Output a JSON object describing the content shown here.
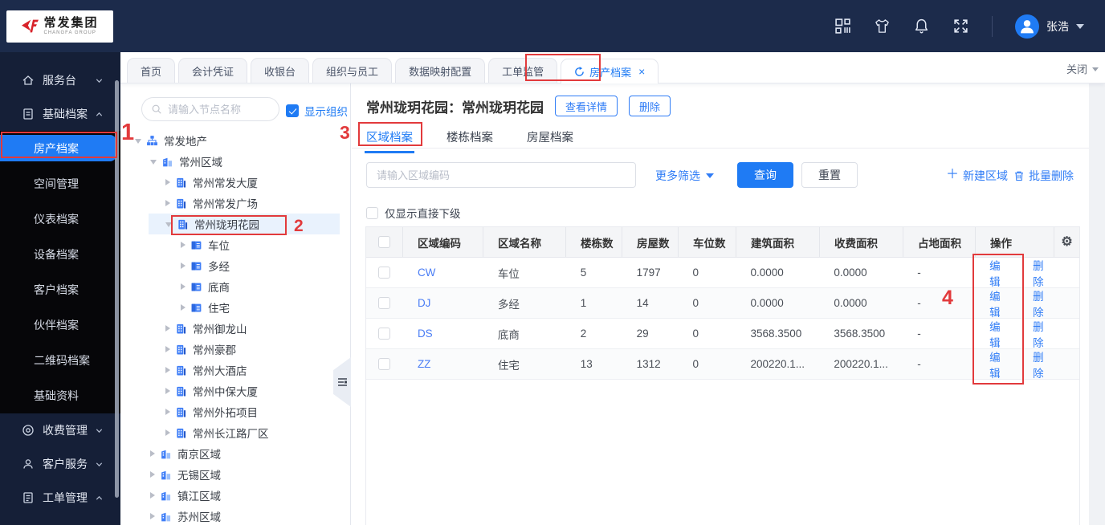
{
  "header": {
    "logo": {
      "title": "常发集团",
      "subtitle": "CHANGFA GROUP"
    },
    "icons": [
      "qrcode-icon",
      "theme-shirt-icon",
      "notifications-bell-icon",
      "fullscreen-icon"
    ],
    "user_name": "张浩"
  },
  "tab_bar": {
    "tabs": [
      {
        "label": "首页"
      },
      {
        "label": "会计凭证"
      },
      {
        "label": "收银台"
      },
      {
        "label": "组织与员工"
      },
      {
        "label": "数据映射配置"
      },
      {
        "label": "工单监管"
      },
      {
        "label": "房产档案",
        "active": true,
        "closable": true
      }
    ],
    "close_menu_label": "关闭"
  },
  "sidebar": {
    "groups": [
      {
        "label": "服务台",
        "icon": "home",
        "chevron": "down"
      },
      {
        "label": "基础档案",
        "icon": "archive",
        "chevron": "up",
        "children": [
          {
            "label": "房产档案",
            "active": true
          },
          {
            "label": "空间管理"
          },
          {
            "label": "仪表档案"
          },
          {
            "label": "设备档案"
          },
          {
            "label": "客户档案"
          },
          {
            "label": "伙伴档案"
          },
          {
            "label": "二维码档案"
          },
          {
            "label": "基础资料"
          }
        ]
      },
      {
        "label": "收费管理",
        "icon": "fee",
        "chevron": "down"
      },
      {
        "label": "客户服务",
        "icon": "customer",
        "chevron": "down"
      },
      {
        "label": "工单管理",
        "icon": "workorder",
        "chevron": "up"
      }
    ]
  },
  "tree_panel": {
    "search_placeholder": "请输入节点名称",
    "show_org": {
      "label": "显示组织",
      "checked": true
    },
    "nodes": [
      {
        "label": "常发地产",
        "level": 0,
        "icon": "org",
        "state": "open"
      },
      {
        "label": "常州区域",
        "level": 1,
        "icon": "region",
        "state": "open"
      },
      {
        "label": "常州常发大厦",
        "level": 2,
        "icon": "project",
        "state": "closed"
      },
      {
        "label": "常州常发广场",
        "level": 2,
        "icon": "project",
        "state": "closed"
      },
      {
        "label": "常州珑玥花园",
        "level": 2,
        "icon": "project",
        "state": "open",
        "selected": true
      },
      {
        "label": "车位",
        "level": 3,
        "icon": "category",
        "state": "closed"
      },
      {
        "label": "多经",
        "level": 3,
        "icon": "category",
        "state": "closed"
      },
      {
        "label": "底商",
        "level": 3,
        "icon": "category",
        "state": "closed"
      },
      {
        "label": "住宅",
        "level": 3,
        "icon": "category",
        "state": "closed"
      },
      {
        "label": "常州御龙山",
        "level": 2,
        "icon": "project",
        "state": "closed"
      },
      {
        "label": "常州豪郡",
        "level": 2,
        "icon": "project",
        "state": "closed"
      },
      {
        "label": "常州大酒店",
        "level": 2,
        "icon": "project",
        "state": "closed"
      },
      {
        "label": "常州中保大厦",
        "level": 2,
        "icon": "project",
        "state": "closed"
      },
      {
        "label": "常州外拓项目",
        "level": 2,
        "icon": "project",
        "state": "closed"
      },
      {
        "label": "常州长江路厂区",
        "level": 2,
        "icon": "project",
        "state": "closed"
      },
      {
        "label": "南京区域",
        "level": 1,
        "icon": "region",
        "state": "closed"
      },
      {
        "label": "无锡区域",
        "level": 1,
        "icon": "region",
        "state": "closed"
      },
      {
        "label": "镇江区域",
        "level": 1,
        "icon": "region",
        "state": "closed"
      },
      {
        "label": "苏州区域",
        "level": 1,
        "icon": "region",
        "state": "closed"
      }
    ]
  },
  "main": {
    "title": "常州珑玥花园：常州珑玥花园",
    "actions": {
      "view_detail": "查看详情",
      "delete": "删除"
    },
    "tabs": [
      {
        "label": "区域档案",
        "active": true
      },
      {
        "label": "楼栋档案"
      },
      {
        "label": "房屋档案"
      }
    ],
    "filter": {
      "placeholder": "请输入区域编码",
      "more_filters": "更多筛选",
      "query": "查询",
      "reset": "重置",
      "create_region": "新建区域",
      "batch_delete": "批量删除"
    },
    "only_direct_label": "仅显示直接下级",
    "table": {
      "columns": [
        "区域编码",
        "区域名称",
        "楼栋数",
        "房屋数",
        "车位数",
        "建筑面积",
        "收费面积",
        "占地面积",
        "操作"
      ],
      "rows": [
        {
          "code": "CW",
          "name": "车位",
          "buildings": "5",
          "houses": "1797",
          "parking": "0",
          "build_area": "0.0000",
          "charge_area": "0.0000",
          "land_area": "-"
        },
        {
          "code": "DJ",
          "name": "多经",
          "buildings": "1",
          "houses": "14",
          "parking": "0",
          "build_area": "0.0000",
          "charge_area": "0.0000",
          "land_area": "-"
        },
        {
          "code": "DS",
          "name": "底商",
          "buildings": "2",
          "houses": "29",
          "parking": "0",
          "build_area": "3568.3500",
          "charge_area": "3568.3500",
          "land_area": "-"
        },
        {
          "code": "ZZ",
          "name": "住宅",
          "buildings": "13",
          "houses": "1312",
          "parking": "0",
          "build_area": "200220.1...",
          "charge_area": "200220.1...",
          "land_area": "-"
        }
      ],
      "row_actions": {
        "edit": "编辑",
        "delete": "删除"
      }
    }
  },
  "annotations": {
    "labels": [
      "1",
      "2",
      "3",
      "4"
    ]
  },
  "colors": {
    "accent_blue": "#1f7bf4",
    "link_blue": "#2f7cf6",
    "annotation_red": "#e23a3c",
    "header_navy": "#1c2b4b",
    "sidebar_navy": "#151f37",
    "submenu_black": "#060609",
    "logo_red": "#d8232a"
  }
}
